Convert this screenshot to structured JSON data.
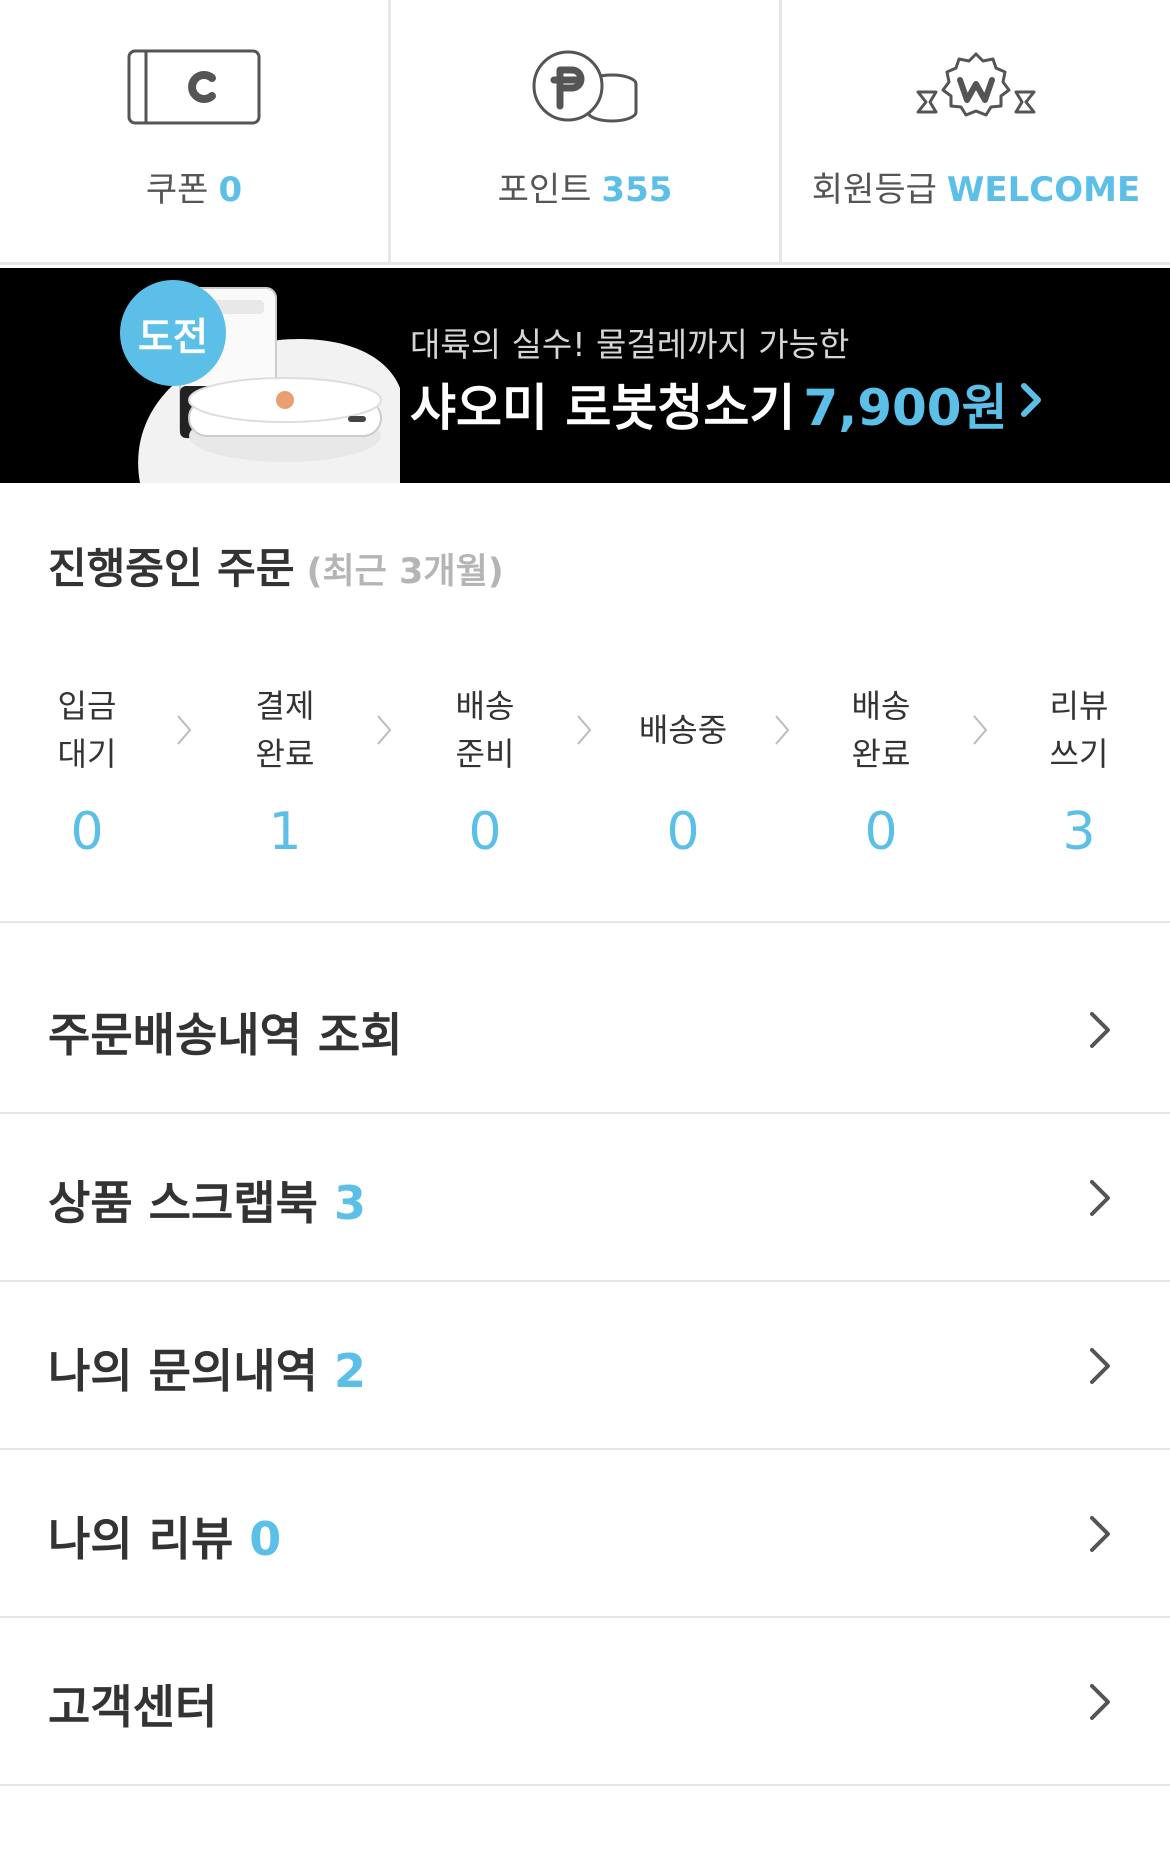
{
  "stats": [
    {
      "label": "쿠폰",
      "value": "0",
      "icon": "coupon-icon"
    },
    {
      "label": "포인트",
      "value": "355",
      "icon": "point-coin-icon"
    },
    {
      "label": "회원등급",
      "value": "WELCOME",
      "icon": "membership-badge-icon"
    }
  ],
  "banner": {
    "badge": "도전",
    "subtitle": "대륙의 실수! 물걸레까지 가능한",
    "title": "샤오미 로봇청소기",
    "price": "7,900원"
  },
  "orders": {
    "title": "진행중인 주문",
    "period": "(최근 3개월)",
    "steps": [
      {
        "line1": "입금",
        "line2": "대기",
        "count": "0"
      },
      {
        "line1": "결제",
        "line2": "완료",
        "count": "1"
      },
      {
        "line1": "배송",
        "line2": "준비",
        "count": "0"
      },
      {
        "line1": "배송중",
        "line2": "",
        "count": "0"
      },
      {
        "line1": "배송",
        "line2": "완료",
        "count": "0"
      },
      {
        "line1": "리뷰",
        "line2": "쓰기",
        "count": "3"
      }
    ]
  },
  "menu": [
    {
      "label": "주문배송내역 조회",
      "count": ""
    },
    {
      "label": "상품 스크랩북",
      "count": "3"
    },
    {
      "label": "나의 문의내역",
      "count": "2"
    },
    {
      "label": "나의 리뷰",
      "count": "0"
    },
    {
      "label": "고객센터",
      "count": ""
    }
  ],
  "colors": {
    "accent": "#5bbfe8",
    "text": "#333333",
    "divider": "#e6e6e6"
  }
}
